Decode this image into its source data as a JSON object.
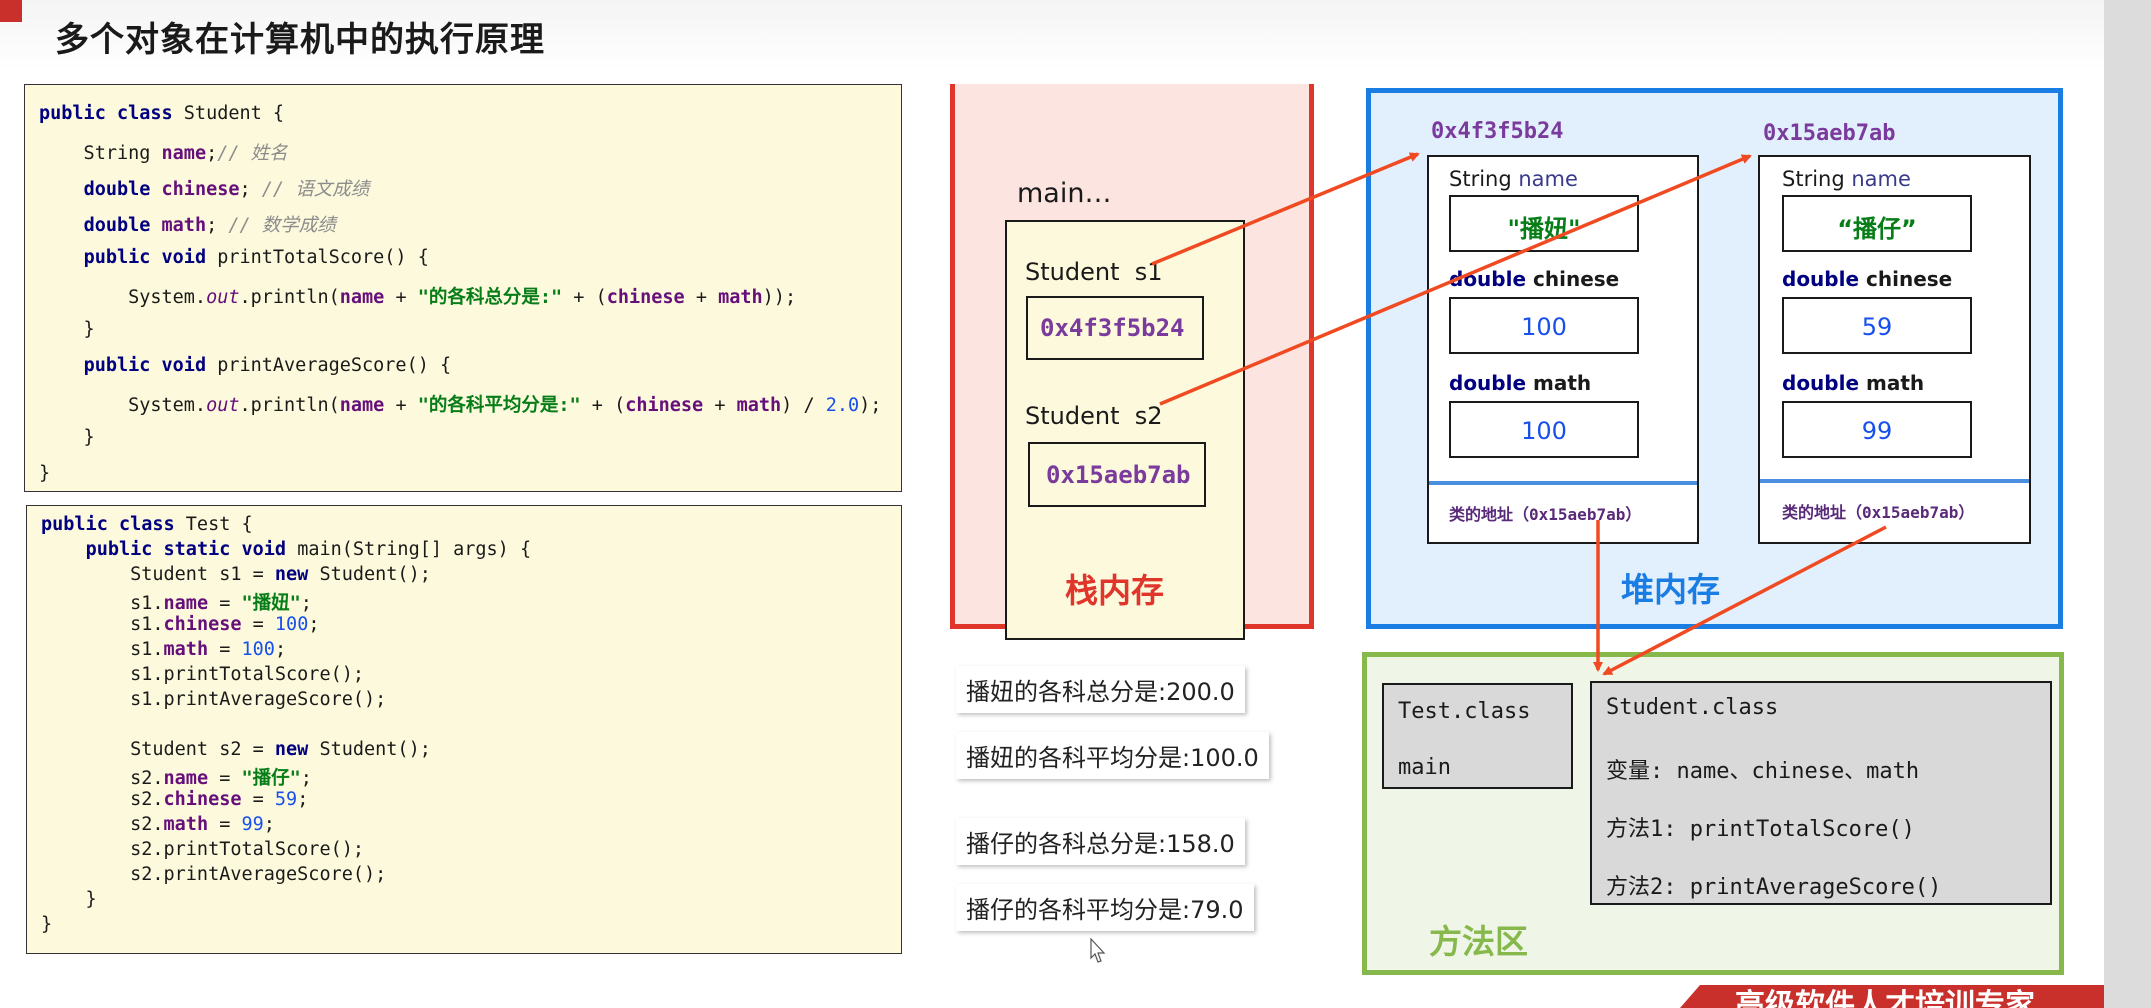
{
  "title": "多个对象在计算机中的执行原理",
  "code_student": [
    "public class Student {",
    "    String name;// 姓名",
    "    double chinese; // 语文成绩",
    "    double math; // 数学成绩",
    "    public void printTotalScore() {",
    "        System.out.println(name + \"的各科总分是:\" + (chinese + math));",
    "    }",
    "    public void printAverageScore() {",
    "        System.out.println(name + \"的各科平均分是:\" + (chinese + math) / 2.0);",
    "    }",
    "}"
  ],
  "code_test": [
    "public class Test {",
    "    public static void main(String[] args) {",
    "        Student s1 = new Student();",
    "        s1.name = \"播妞\";",
    "        s1.chinese = 100;",
    "        s1.math = 100;",
    "        s1.printTotalScore();",
    "        s1.printAverageScore();",
    "",
    "        Student s2 = new Student();",
    "        s2.name = \"播仔\";",
    "        s2.chinese = 59;",
    "        s2.math = 99;",
    "        s2.printTotalScore();",
    "        s2.printAverageScore();",
    "    }",
    "}"
  ],
  "stack": {
    "label": "栈内存",
    "frame_label": "main…",
    "s1_label": "Student  s1",
    "s1_value": "0x4f3f5b24",
    "s2_label": "Student  s2",
    "s2_value": "0x15aeb7ab"
  },
  "heap": {
    "label": "堆内存",
    "objects": [
      {
        "address": "0x4f3f5b24",
        "name_type": "String",
        "name_field": "name",
        "name_value": "\"播妞\"",
        "chinese_type": "double",
        "chinese_field": "chinese",
        "chinese_value": "100",
        "math_type": "double",
        "math_field": "math",
        "math_value": "100",
        "class_addr_label": "类的地址（",
        "class_addr_value": "0x15aeb7ab",
        "class_addr_close": "）"
      },
      {
        "address": "0x15aeb7ab",
        "name_type": "String",
        "name_field": "name",
        "name_value": "“播仔”",
        "chinese_type": "double",
        "chinese_field": "chinese",
        "chinese_value": "59",
        "math_type": "double",
        "math_field": "math",
        "math_value": "99",
        "class_addr_label": "类的地址（",
        "class_addr_value": "0x15aeb7ab",
        "class_addr_close": "）"
      }
    ]
  },
  "method_area": {
    "label": "方法区",
    "test_class": "Test.class",
    "test_main": "main",
    "student_class": "Student.class",
    "vars": "变量: name、chinese、math",
    "method1": "方法1: printTotalScore()",
    "method2": "方法2: printAverageScore()"
  },
  "results": [
    "播妞的各科总分是:200.0",
    "播妞的各科平均分是:100.0",
    "播仔的各科总分是:158.0",
    "播仔的各科平均分是:79.0"
  ],
  "footer": "高级软件人才培训专家",
  "colors": {
    "stack_border": "#e0352b",
    "heap_border": "#1a7de3",
    "method_border": "#86b84c",
    "arrow": "#f04a22",
    "stack_label": "#e0352b",
    "heap_label": "#1a7de3",
    "method_label": "#86b84c",
    "address": "#7a3b9c"
  }
}
